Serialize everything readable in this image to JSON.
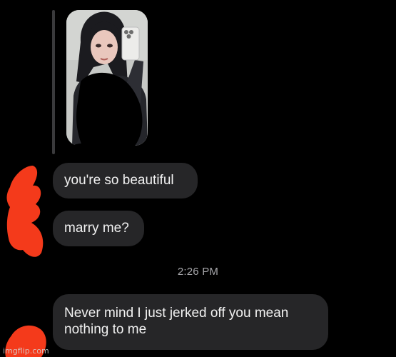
{
  "story_reply": {
    "photo_icon": "selfie-photo"
  },
  "messages": [
    {
      "text": "you're so beautiful"
    },
    {
      "text": "marry me?"
    },
    {
      "text": "Never mind I just jerked off you mean nothing to me"
    }
  ],
  "timestamp": "2:26 PM",
  "watermark": "imgflip.com",
  "colors": {
    "background": "#000000",
    "bubble": "#262628",
    "timestamp": "#a8a8ac",
    "censor_red": "#f43a1b"
  }
}
